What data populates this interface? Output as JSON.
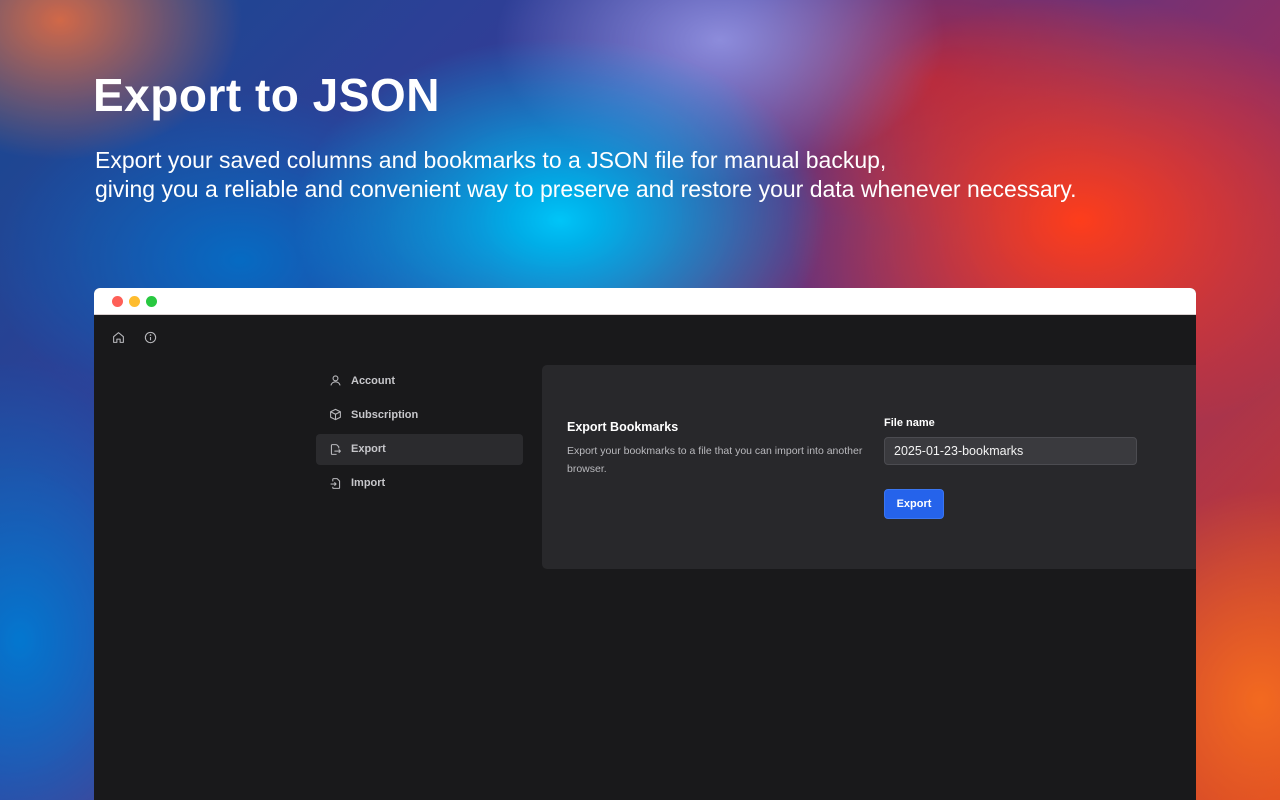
{
  "hero": {
    "title": "Export to JSON",
    "subtitle_line1": "Export your saved columns and bookmarks to a JSON file for manual backup,",
    "subtitle_line2": "giving you a reliable and convenient way to preserve and restore your data whenever necessary."
  },
  "window": {
    "traffic_lights": {
      "close": "#fe5f57",
      "minimize": "#febc2e",
      "zoom": "#28c840"
    },
    "toolbar": {
      "icons": [
        "home-icon",
        "info-icon"
      ]
    }
  },
  "sidebar": {
    "items": [
      {
        "label": "Account",
        "icon": "user-icon",
        "active": false
      },
      {
        "label": "Subscription",
        "icon": "box-icon",
        "active": false
      },
      {
        "label": "Export",
        "icon": "file-export-icon",
        "active": true
      },
      {
        "label": "Import",
        "icon": "file-import-icon",
        "active": false
      }
    ]
  },
  "panel": {
    "title": "Export Bookmarks",
    "description": "Export your bookmarks to a file that you can import into another browser.",
    "file_label": "File name",
    "file_value": "2025-01-23-bookmarks",
    "export_button": "Export"
  },
  "colors": {
    "accent": "#2563eb",
    "app_background": "#19191b",
    "panel_background": "#28282b"
  }
}
